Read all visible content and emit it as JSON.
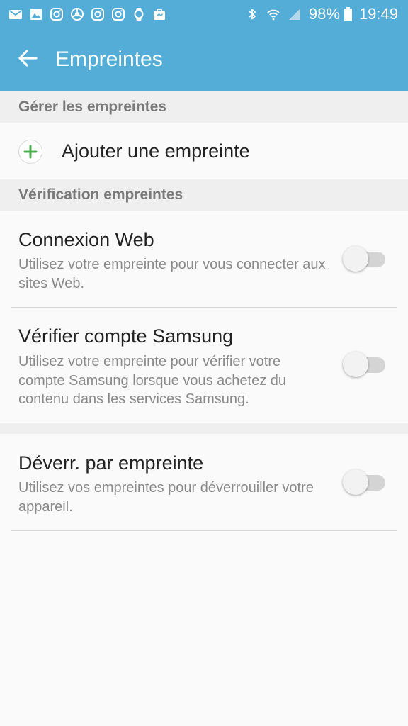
{
  "status_bar": {
    "notification_icons": [
      "email-icon",
      "gallery-icon",
      "instagram-icon",
      "chrome-icon",
      "instagram-icon",
      "instagram-icon",
      "watch-icon",
      "briefcase-icon"
    ],
    "system_icons": [
      "bluetooth-icon",
      "wifi-icon",
      "signal-icon"
    ],
    "battery_percent": "98%",
    "battery_level": 0.98,
    "time": "19:49"
  },
  "app_bar": {
    "title": "Empreintes",
    "back_icon": "back-arrow-icon",
    "background_color": "#54add6"
  },
  "sections": {
    "manage_header": "Gérer les empreintes",
    "add_fingerprint": {
      "label": "Ajouter une empreinte",
      "icon": "plus-icon",
      "icon_color": "#4caf50"
    },
    "verification_header": "Vérification empreintes"
  },
  "settings": [
    {
      "title": "Connexion Web",
      "description": "Utilisez votre empreinte pour vous connecter aux sites Web.",
      "enabled": false
    },
    {
      "title": "Vérifier compte Samsung",
      "description": "Utilisez votre empreinte pour vérifier votre compte Samsung lorsque vous achetez du contenu dans les services Samsung.",
      "enabled": false
    },
    {
      "title": "Déverr. par empreinte",
      "description": "Utilisez vos empreintes pour déverrouiller votre appareil.",
      "enabled": false
    }
  ]
}
